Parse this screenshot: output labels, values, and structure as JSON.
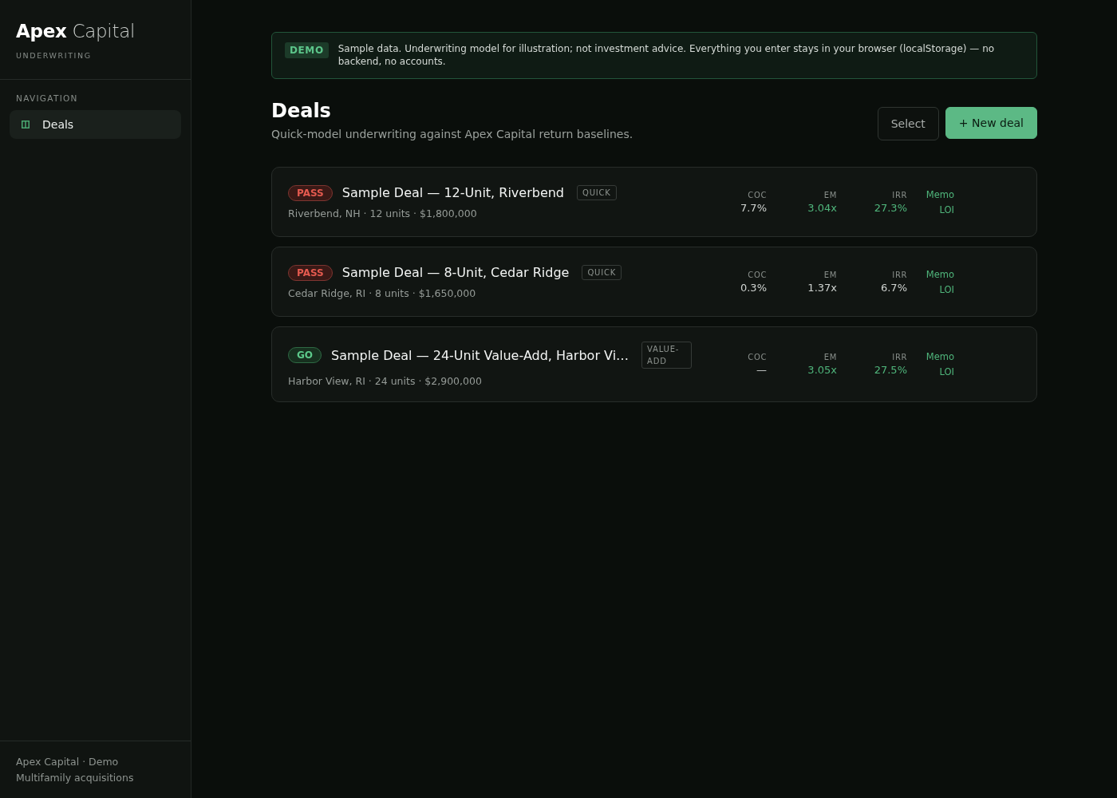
{
  "sidebar": {
    "brand": "**Apex** Capital",
    "subtitle": "UNDERWRITING",
    "nav_heading": "NAVIGATION",
    "nav_items": [
      {
        "label": "Deals",
        "selected": true
      }
    ],
    "footer": [
      "Apex Capital · Demo",
      "Multifamily acquisitions"
    ]
  },
  "notice": {
    "badge": "DEMO",
    "text": "Sample data. Underwriting model for illustration; not investment advice. Everything you enter stays in your browser (localStorage) — no backend, no accounts."
  },
  "header": {
    "title": "Deals",
    "subtitle": "Quick-model underwriting against Apex Capital return baselines.",
    "buttons": [
      {
        "label": "Select",
        "kind": "secondary"
      },
      {
        "label": "+ New deal",
        "kind": "primary"
      }
    ]
  },
  "deals": [
    {
      "verdict": {
        "label": "PASS",
        "kind": "pass"
      },
      "title": "Sample Deal — 12-Unit, Riverbend",
      "tag": "QUICK",
      "details": "Riverbend, NH · 12 units · $1,800,000",
      "metrics": [
        {
          "label": "COC",
          "value": "7.7%",
          "good": false
        },
        {
          "label": "EM",
          "value": "3.04x",
          "good": true
        },
        {
          "label": "IRR",
          "value": "27.3%",
          "good": true
        }
      ],
      "links": [
        "Memo",
        "LOI"
      ]
    },
    {
      "verdict": {
        "label": "PASS",
        "kind": "pass"
      },
      "title": "Sample Deal — 8-Unit, Cedar Ridge",
      "tag": "QUICK",
      "details": "Cedar Ridge, RI · 8 units · $1,650,000",
      "metrics": [
        {
          "label": "COC",
          "value": "0.3%",
          "good": false
        },
        {
          "label": "EM",
          "value": "1.37x",
          "good": false
        },
        {
          "label": "IRR",
          "value": "6.7%",
          "good": false
        }
      ],
      "links": [
        "Memo",
        "LOI"
      ]
    },
    {
      "verdict": {
        "label": "GO",
        "kind": "go"
      },
      "title": "Sample Deal — 24-Unit Value-Add, Harbor Vi…",
      "tag": "VALUE-ADD",
      "details": "Harbor View, RI · 24 units · $2,900,000",
      "metrics": [
        {
          "label": "COC",
          "value": "—",
          "good": false
        },
        {
          "label": "EM",
          "value": "3.05x",
          "good": true
        },
        {
          "label": "IRR",
          "value": "27.5%",
          "good": true
        }
      ],
      "links": [
        "Memo",
        "LOI"
      ]
    }
  ]
}
